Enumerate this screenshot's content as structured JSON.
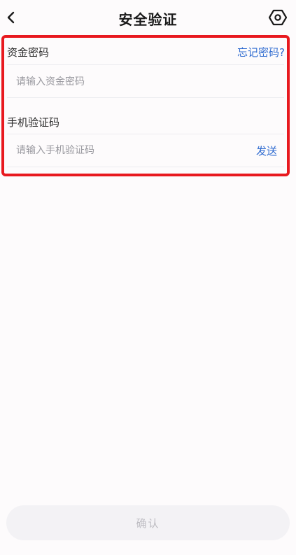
{
  "header": {
    "title": "安全验证",
    "back_icon": "chevron-left-icon",
    "settings_icon": "hexagon-settings-icon"
  },
  "form": {
    "fund_password": {
      "label": "资金密码",
      "forgot_link": "忘记密码?",
      "placeholder": "请输入资金密码",
      "value": ""
    },
    "sms_code": {
      "label": "手机验证码",
      "send_link": "发送",
      "placeholder": "请输入手机验证码",
      "value": ""
    }
  },
  "footer": {
    "confirm_label": "确认"
  },
  "colors": {
    "link": "#2f6bd0",
    "highlight_border": "#e8191f",
    "disabled_button_bg": "#f3f2f5",
    "disabled_button_text": "#bdbcc2"
  }
}
